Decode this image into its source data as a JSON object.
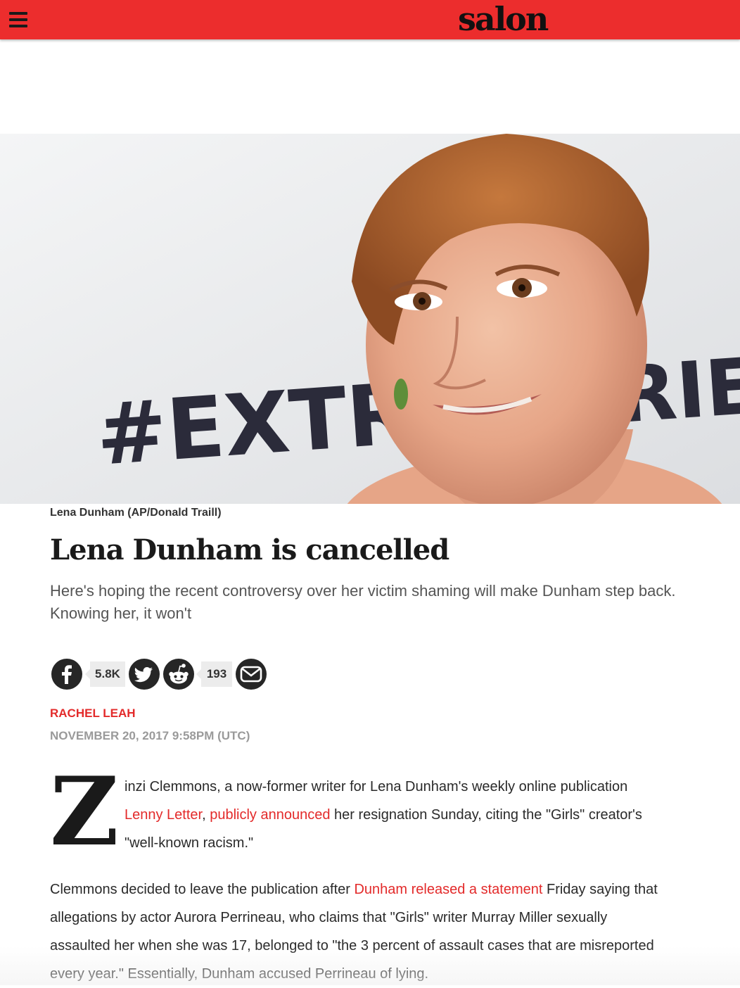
{
  "header": {
    "logo": "salon",
    "brand_color": "#ec2d2d"
  },
  "hero": {
    "caption": "Lena Dunham (AP/Donald Traill)",
    "backdrop_text": "#EXTRA",
    "backdrop_text_right": "RIES"
  },
  "article": {
    "title": "Lena Dunham is cancelled",
    "dek": "Here's hoping the recent controversy over her victim shaming will make Dunham step back. Knowing her, it won't",
    "author": "RACHEL LEAH",
    "date": "NOVEMBER 20, 2017 9:58PM (UTC)",
    "dropcap": "Z",
    "p1": {
      "t1": "inzi Clemmons, a now-former writer for Lena Dunham's weekly online publication ",
      "link1": "Lenny Letter",
      "t2": ", ",
      "link2": "publicly announced",
      "t3": " her resignation Sunday, citing the \"Girls\" creator's \"well-known racism.\""
    },
    "p2": {
      "t1": "Clemmons decided to leave the publication after ",
      "link1": "Dunham released a statement",
      "t2": " Friday saying that allegations by actor Aurora Perrineau, who claims that \"Girls\" writer Murray Miller sexually assaulted her when she was 17, belonged to \"the 3 percent of assault cases that are misreported every year.\" Essentially, Dunham accused Perrineau of lying."
    }
  },
  "share": {
    "facebook_icon": "facebook-icon",
    "facebook_count": "5.8K",
    "twitter_icon": "twitter-icon",
    "reddit_icon": "reddit-icon",
    "reddit_count": "193",
    "email_icon": "email-icon"
  }
}
